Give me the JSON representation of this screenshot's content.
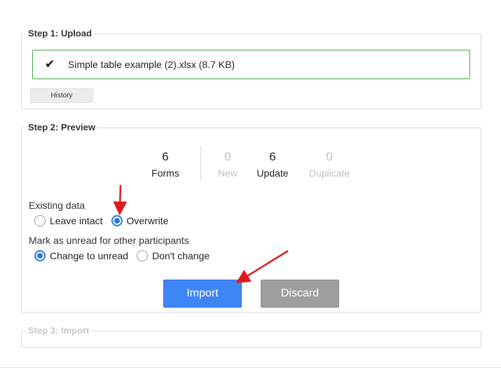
{
  "step1": {
    "legend": "Step 1: Upload",
    "file_check_icon": "checkmark-icon",
    "file_name": "Simple table example (2).xlsx (8.7 KB)",
    "history_label": "History"
  },
  "step2": {
    "legend": "Step 2: Preview",
    "stats": [
      {
        "number": "6",
        "label": "Forms"
      },
      {
        "number": "0",
        "label": "New"
      },
      {
        "number": "6",
        "label": "Update"
      },
      {
        "number": "0",
        "label": "Duplicate"
      }
    ],
    "existing_data": {
      "label": "Existing data",
      "options": [
        "Leave intact",
        "Overwrite"
      ],
      "selected": "Overwrite"
    },
    "mark_unread": {
      "label": "Mark as unread for other participants",
      "options": [
        "Change to unread",
        "Don't change"
      ],
      "selected": "Change to unread"
    },
    "import_label": "Import",
    "discard_label": "Discard"
  },
  "step3": {
    "legend": "Step 3: Import"
  },
  "colors": {
    "accent": "#3e86f5",
    "radio_checked": "#2a7ad9",
    "success_border": "#3cab3c",
    "annotation_arrow": "#e0191f",
    "disabled_text": "#bfbfbf"
  }
}
